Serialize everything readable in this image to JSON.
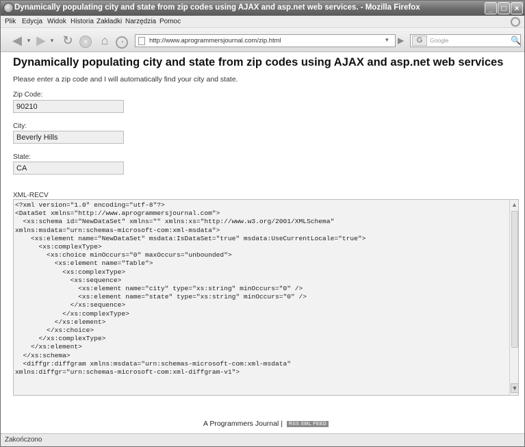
{
  "window": {
    "title": "Dynamically populating city and state from zip codes using AJAX and asp.net web services. - Mozilla Firefox",
    "controls": [
      "_",
      "□",
      "×"
    ]
  },
  "menubar": {
    "items": [
      "Plik",
      "Edycja",
      "Widok",
      "Historia",
      "Zakładki",
      "Narzędzia",
      "Pomoc"
    ]
  },
  "navbar": {
    "url": "http://www.aprogrammersjournal.com/zip.html",
    "search_placeholder": "Google",
    "search_engine_icon": "G",
    "icons": {
      "back": "◀",
      "forward": "▶",
      "reload": "↻",
      "stop": "×",
      "home": "⌂",
      "history": "◔",
      "go": "▶",
      "search_go": "🔍"
    }
  },
  "page": {
    "title": "Dynamically populating city and state from zip codes using AJAX and asp.net web services",
    "intro": "Please enter a zip code and I will automatically find your city and state.",
    "fields": {
      "zip": {
        "label": "Zip Code:",
        "value": "90210"
      },
      "city": {
        "label": "City:",
        "value": "Beverly Hills"
      },
      "state": {
        "label": "State:",
        "value": "CA"
      }
    },
    "xml": {
      "label": "XML-RECV",
      "content": "<?xml version=\"1.0\" encoding=\"utf-8\"?>\n<DataSet xmlns=\"http://www.aprogrammersjournal.com\">\n  <xs:schema id=\"NewDataSet\" xmlns=\"\" xmlns:xs=\"http://www.w3.org/2001/XMLSchema\"\nxmlns:msdata=\"urn:schemas-microsoft-com:xml-msdata\">\n    <xs:element name=\"NewDataSet\" msdata:IsDataSet=\"true\" msdata:UseCurrentLocale=\"true\">\n      <xs:complexType>\n        <xs:choice minOccurs=\"0\" maxOccurs=\"unbounded\">\n          <xs:element name=\"Table\">\n            <xs:complexType>\n              <xs:sequence>\n                <xs:element name=\"city\" type=\"xs:string\" minOccurs=\"0\" />\n                <xs:element name=\"state\" type=\"xs:string\" minOccurs=\"0\" />\n              </xs:sequence>\n            </xs:complexType>\n          </xs:element>\n        </xs:choice>\n      </xs:complexType>\n    </xs:element>\n  </xs:schema>\n  <diffgr:diffgram xmlns:msdata=\"urn:schemas-microsoft-com:xml-msdata\"\nxmlns:diffgr=\"urn:schemas-microsoft-com:xml-diffgram-v1\">"
    },
    "footer": {
      "text": "A Programmers Journal |",
      "badge": "RSS XML FEED"
    }
  },
  "statusbar": {
    "text": "Zakończono"
  }
}
